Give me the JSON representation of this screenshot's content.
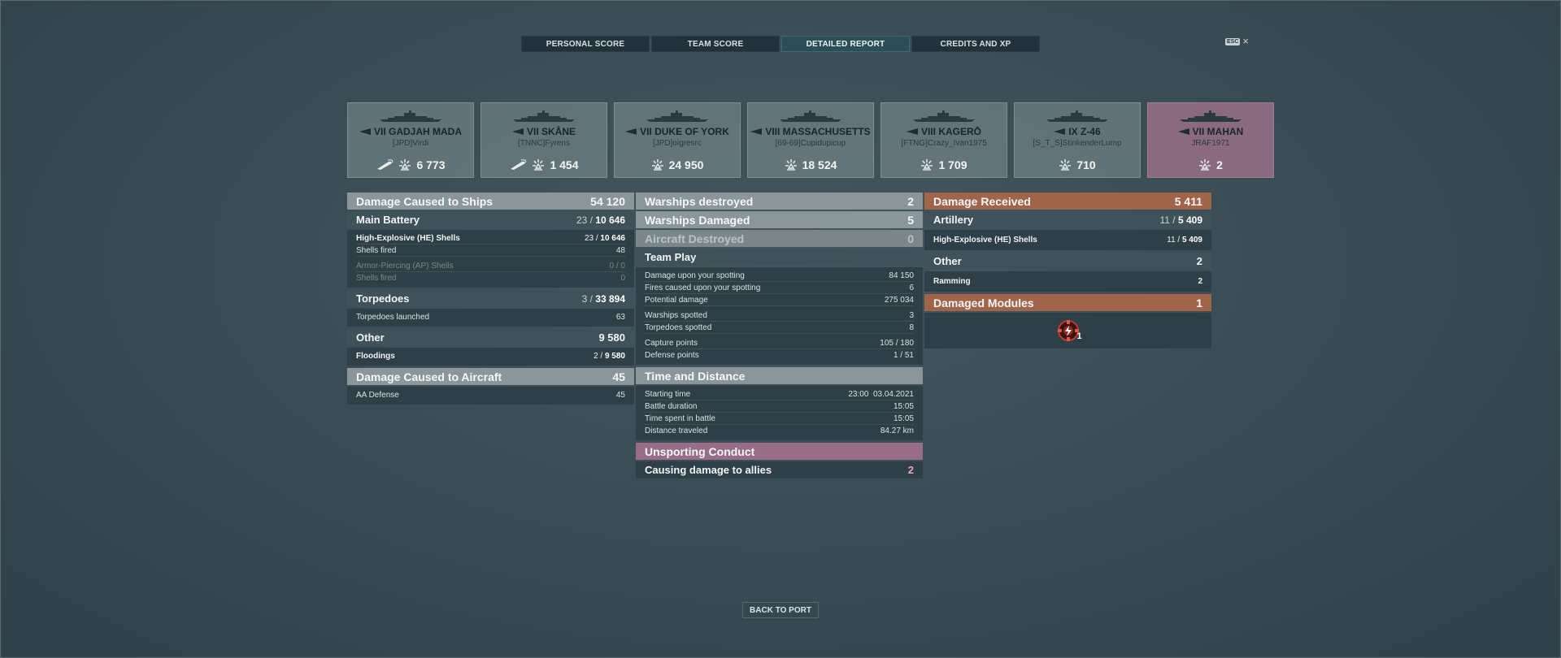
{
  "tabs": [
    "PERSONAL SCORE",
    "TEAM SCORE",
    "DETAILED REPORT",
    "CREDITS AND XP"
  ],
  "esc": {
    "key": "ESC",
    "close": "×"
  },
  "ships": [
    {
      "name": "VII GADJAH MADA",
      "player": "[JPD]Virdi",
      "score": "6 773",
      "torpedo_icon": true
    },
    {
      "name": "VII SKÅNE",
      "player": "[TNNC]Fyrens",
      "score": "1 454",
      "torpedo_icon": true
    },
    {
      "name": "VII DUKE OF YORK",
      "player": "[JPD]oigresrc",
      "score": "24 950"
    },
    {
      "name": "VIII MASSACHUSETTS",
      "player": "[69-69]Cupidupicup",
      "score": "18 524"
    },
    {
      "name": "VIII KAGERŌ",
      "player": "[FTNG]Crazy_Ivan1975",
      "score": "1 709"
    },
    {
      "name": "IX Z-46",
      "player": "[S_T_S]StinkenderLump",
      "score": "710"
    },
    {
      "name": "VII MAHAN",
      "player": "JRAF1971",
      "score": "2"
    }
  ],
  "left": {
    "damage_ships": {
      "label": "Damage Caused to Ships",
      "value": "54 120"
    },
    "main_battery": {
      "label": "Main Battery",
      "hits": "23 /",
      "value": "10 646"
    },
    "he": {
      "label": "High-Explosive (HE) Shells",
      "hits": "23 /",
      "value": "10 646"
    },
    "he_fired": {
      "label": "Shells fired",
      "value": "48"
    },
    "ap": {
      "label": "Armor-Piercing (AP) Shells",
      "value": "0 / 0"
    },
    "ap_fired": {
      "label": "Shells fired",
      "value": "0"
    },
    "torpedoes": {
      "label": "Torpedoes",
      "hits": "3 /",
      "value": "33 894"
    },
    "torp_launched": {
      "label": "Torpedoes launched",
      "value": "63"
    },
    "other": {
      "label": "Other",
      "value": "9 580"
    },
    "floodings": {
      "label": "Floodings",
      "hits": "2 /",
      "value": "9 580"
    },
    "damage_aircraft": {
      "label": "Damage Caused to Aircraft",
      "value": "45"
    },
    "aa": {
      "label": "AA Defense",
      "value": "45"
    }
  },
  "middle": {
    "destroyed": {
      "label": "Warships destroyed",
      "value": "2"
    },
    "damaged": {
      "label": "Warships Damaged",
      "value": "5"
    },
    "aircraft": {
      "label": "Aircraft Destroyed",
      "value": "0"
    },
    "teamplay": {
      "label": "Team Play"
    },
    "spot_dmg": {
      "label": "Damage upon your spotting",
      "value": "84 150"
    },
    "spot_fires": {
      "label": "Fires caused upon your spotting",
      "value": "6"
    },
    "potential": {
      "label": "Potential damage",
      "value": "275 034"
    },
    "ws_spotted": {
      "label": "Warships spotted",
      "value": "3"
    },
    "tp_spotted": {
      "label": "Torpedoes spotted",
      "value": "8"
    },
    "capture": {
      "label": "Capture points",
      "value": "105 / 180"
    },
    "defense": {
      "label": "Defense points",
      "value": "1 / 51"
    },
    "time": {
      "label": "Time and Distance"
    },
    "start": {
      "label": "Starting time",
      "value": "23:00  03.04.2021"
    },
    "duration": {
      "label": "Battle duration",
      "value": "15:05"
    },
    "spent": {
      "label": "Time spent in battle",
      "value": "15:05"
    },
    "distance": {
      "label": "Distance traveled",
      "value": "84.27 km"
    },
    "unsporting": {
      "label": "Unsporting Conduct"
    },
    "allies": {
      "label": "Causing damage to allies",
      "value": "2"
    }
  },
  "right": {
    "received": {
      "label": "Damage Received",
      "value": "5 411"
    },
    "artillery": {
      "label": "Artillery",
      "hits": "11 /",
      "value": "5 409"
    },
    "he": {
      "label": "High-Explosive (HE) Shells",
      "hits": "11 /",
      "value": "5 409"
    },
    "other": {
      "label": "Other",
      "value": "2"
    },
    "ramming": {
      "label": "Ramming",
      "value": "2"
    },
    "modules": {
      "label": "Damaged Modules",
      "value": "1",
      "count": "1"
    }
  },
  "back": "BACK TO PORT",
  "colors": {
    "brown": "#a0644a",
    "pink": "#976e85",
    "active_tab": "#2c4f57"
  }
}
